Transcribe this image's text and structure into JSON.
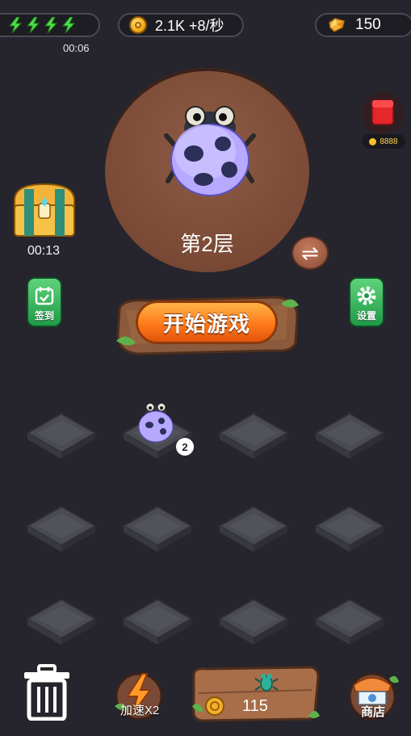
{
  "header": {
    "energy_count": 4,
    "energy_timer": "00:06",
    "coins_text": "2.1K +8/秒",
    "gems_value": "150"
  },
  "stage": {
    "floor_label": "第2层"
  },
  "red_packet": {
    "count": "8888"
  },
  "chest": {
    "timer": "00:13"
  },
  "checkin": {
    "label": "签到"
  },
  "settings": {
    "label": "设置"
  },
  "start_button": {
    "label": "开始游戏"
  },
  "grid": {
    "rows": 3,
    "cols": 4,
    "occupied_tile_level": "2"
  },
  "bottom": {
    "speed_label": "加速X2",
    "buy_price": "115",
    "shop_label": "商店"
  },
  "colors": {
    "background": "#26242c",
    "stage": "#7a4a36",
    "accent_orange": "#ff7a1a",
    "green_button": "#1f9a48"
  }
}
